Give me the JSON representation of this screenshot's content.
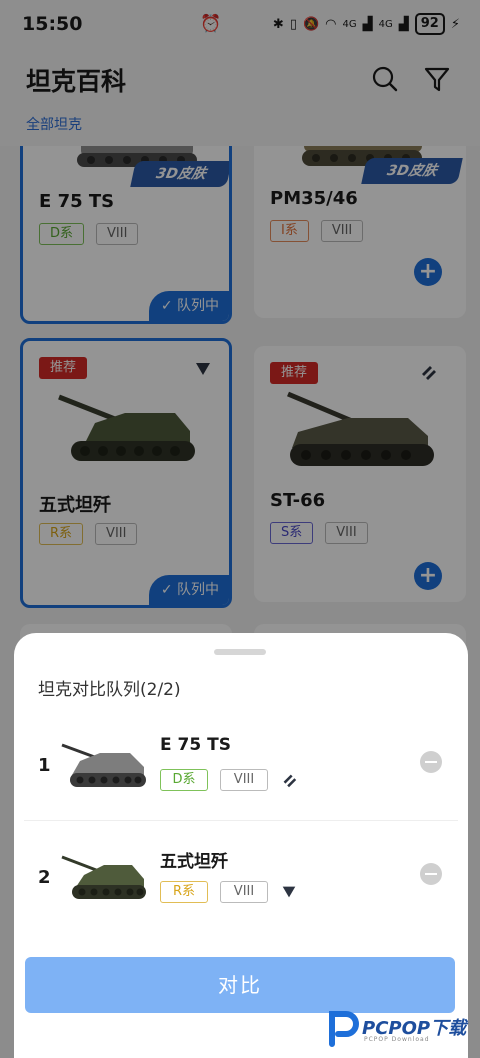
{
  "status_bar": {
    "time": "15:50",
    "battery": "92",
    "signal_1": "4G",
    "signal_2": "4G"
  },
  "header": {
    "title": "坦克百科",
    "subtitle": "全部坦克",
    "icons": [
      "search-icon",
      "filter-icon"
    ]
  },
  "cards": [
    {
      "name": "E 75 TS",
      "nation": "D系",
      "tier": "VIII",
      "badge": "3D皮肤",
      "queue_label": "队列中",
      "selected": true
    },
    {
      "name": "PM35/46",
      "nation": "I系",
      "tier": "VIII",
      "badge": "3D皮肤",
      "selected": false
    },
    {
      "name": "五式坦歼",
      "nation": "R系",
      "tier": "VIII",
      "tag": "推荐",
      "queue_label": "队列中",
      "selected": true
    },
    {
      "name": "ST-66",
      "nation": "S系",
      "tier": "VIII",
      "tag": "推荐",
      "selected": false
    }
  ],
  "sheet": {
    "title": "坦克对比队列(2/2)",
    "items": [
      {
        "index": "1",
        "name": "E 75 TS",
        "nation": "D系",
        "tier": "VIII",
        "type_icon": "heavy-tank-icon"
      },
      {
        "index": "2",
        "name": "五式坦歼",
        "nation": "R系",
        "tier": "VIII",
        "type_icon": "tank-destroyer-icon"
      }
    ],
    "compare_label": "对比"
  },
  "watermark": {
    "text": "PCPOP下载",
    "sub": "PCPOP Download"
  },
  "colors": {
    "accent": "#1e6fd9",
    "recommend": "#d42a26",
    "compare_button": "#7eb2f5"
  }
}
